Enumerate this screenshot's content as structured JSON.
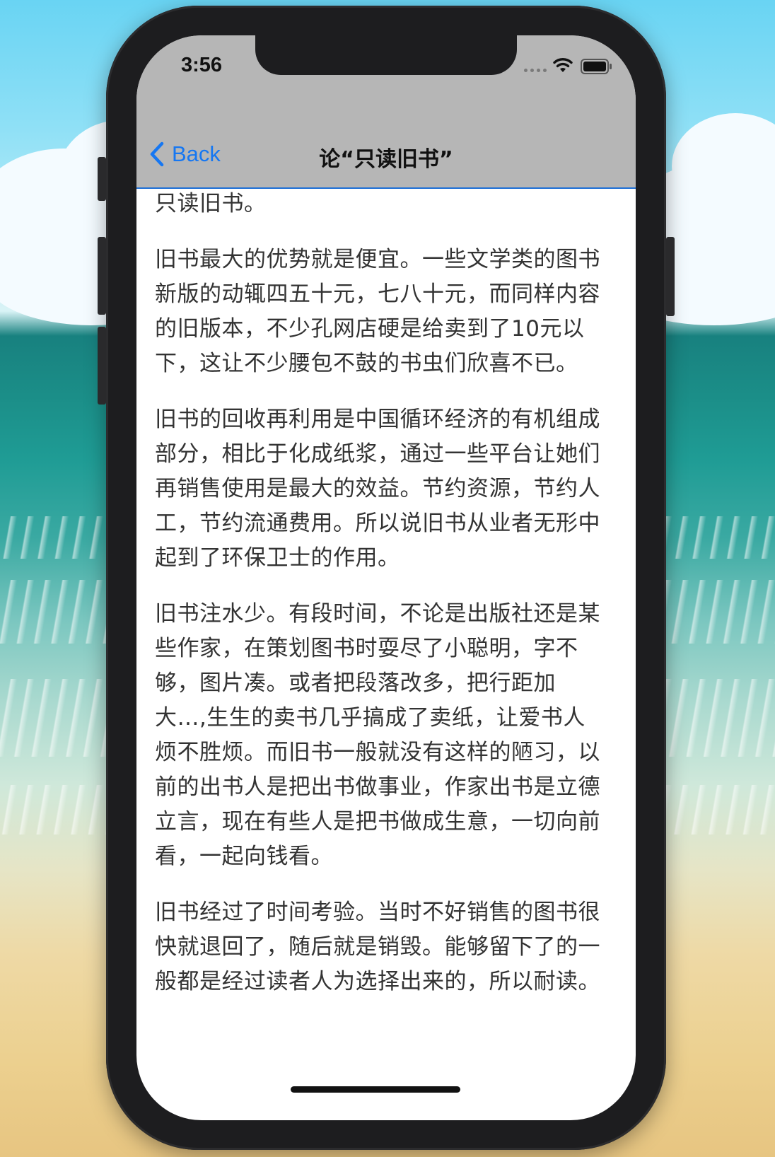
{
  "status_bar": {
    "time": "3:56",
    "wifi_icon": "wifi-icon",
    "battery_icon": "battery-icon",
    "signal_icon": "signal-dots-icon"
  },
  "nav": {
    "back_label": "Back",
    "title": "论“只读旧书”",
    "back_icon": "chevron-left-icon",
    "accent_color": "#1677f2",
    "bar_color": "#b6b6b6"
  },
  "article": {
    "paragraphs": [
      "只读旧书。",
      "旧书最大的优势就是便宜。一些文学类的图书新版的动辄四五十元，七八十元，而同样内容的旧版本，不少孔网店硬是给卖到了10元以下，这让不少腰包不鼓的书虫们欣喜不已。",
      "旧书的回收再利用是中国循环经济的有机组成部分，相比于化成纸浆，通过一些平台让她们再销售使用是最大的效益。节约资源，节约人工，节约流通费用。所以说旧书从业者无形中起到了环保卫士的作用。",
      "旧书注水少。有段时间，不论是出版社还是某些作家，在策划图书时耍尽了小聪明，字不够，图片凑。或者把段落改多，把行距加大…,生生的卖书几乎搞成了卖纸，让爱书人烦不胜烦。而旧书一般就没有这样的陋习，以前的出书人是把出书做事业，作家出书是立德立言，现在有些人是把书做成生意，一切向前看，一起向钱看。",
      "旧书经过了时间考验。当时不好销售的图书很快就退回了，随后就是销毁。能够留下了的一般都是经过读者人为选择出来的，所以耐读。"
    ]
  }
}
